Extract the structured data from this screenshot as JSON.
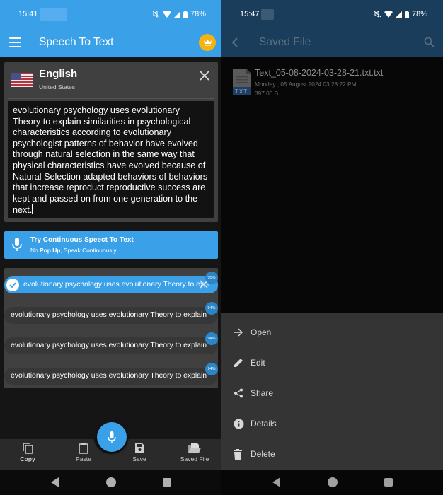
{
  "left_screen": {
    "status_bar": {
      "time": "15:41",
      "battery": "78%"
    },
    "app_bar": {
      "title": "Speech To Text",
      "menu_icon": "hamburger-menu-icon",
      "premium_icon": "crown-icon",
      "colors": {
        "primary": "#3aa0e8",
        "premium": "#f5b312"
      }
    },
    "language_card": {
      "flag": "us-flag-icon",
      "language": "English",
      "region": "United States",
      "close_icon": "close-icon",
      "transcript": "evolutionary psychology uses evolutionary Theory to explain similarities in psychological characteristics according to evolutionary psychologist patterns of behavior have evolved through natural selection in the same way that physical characteristics have evolved because of Natural Selection adapted behaviors of behaviors that increase reproduct reproductive success are kept and passed on from one generation to the next."
    },
    "continuous_banner": {
      "icon": "microphone-icon",
      "title": "Try Continuous Speect To Text",
      "subtitle_prefix": "No ",
      "subtitle_bold": "Pop Up",
      "subtitle_suffix": ", Speak Continuously"
    },
    "suggestions": [
      {
        "text": "evolutionary psychology uses evolutionary Theory to expl",
        "confidence": "95%",
        "selected": true
      },
      {
        "text": "evolutionary psychology uses evolutionary Theory to explain",
        "confidence": "94%",
        "selected": false
      },
      {
        "text": "evolutionary psychology uses evolutionary Theory to explain",
        "confidence": "94%",
        "selected": false
      },
      {
        "text": "evolutionary psychology uses evolutionary Theory to explain",
        "confidence": "94%",
        "selected": false
      }
    ],
    "bottom_bar": {
      "copy": "Copy",
      "paste": "Paste",
      "save": "Save",
      "saved_file": "Saved File",
      "fab_icon": "microphone-icon"
    }
  },
  "right_screen": {
    "status_bar": {
      "time": "15:47",
      "battery": "78%"
    },
    "app_bar": {
      "title": "Saved File",
      "back_icon": "chevron-left-icon",
      "search_icon": "search-icon",
      "color": "#1a3d5c"
    },
    "files": [
      {
        "name": "Text_05-08-2024-03-28-21.txt.txt",
        "date": "Monday , 05 August 2024 03:28:22 PM",
        "size": "397.00 B",
        "type_label": "TXT"
      }
    ],
    "action_sheet": [
      {
        "label": "Open",
        "icon": "arrow-right-icon"
      },
      {
        "label": "Edit",
        "icon": "pencil-icon"
      },
      {
        "label": "Share",
        "icon": "share-icon"
      },
      {
        "label": "Details",
        "icon": "info-icon"
      },
      {
        "label": "Delete",
        "icon": "trash-icon"
      }
    ]
  }
}
